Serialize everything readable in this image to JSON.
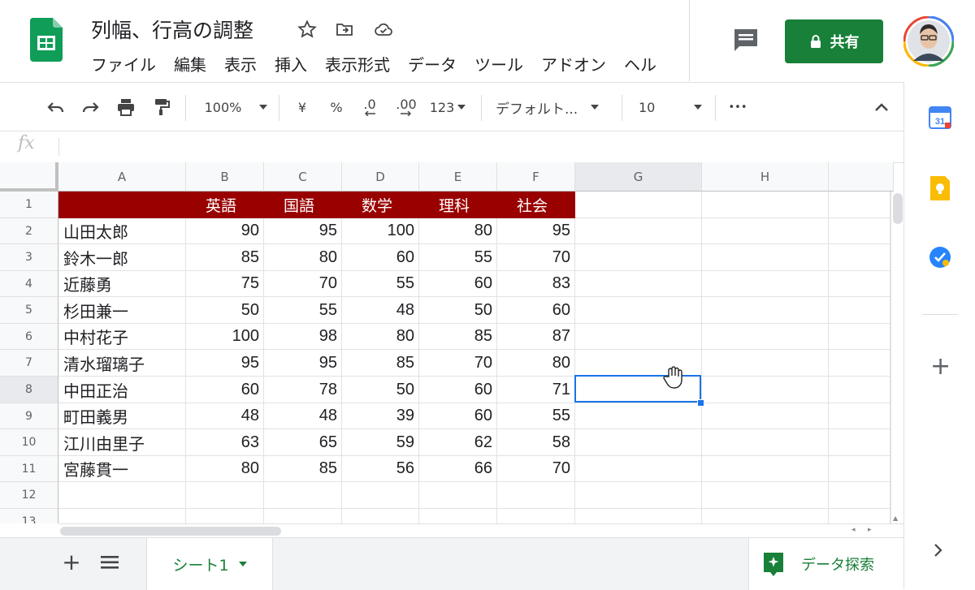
{
  "app": {
    "title": "列幅、行高の調整",
    "menu": [
      "ファイル",
      "編集",
      "表示",
      "挿入",
      "表示形式",
      "データ",
      "ツール",
      "アドオン",
      "ヘル"
    ],
    "share_label": "共有"
  },
  "toolbar": {
    "zoom": "100%",
    "currency": "¥",
    "percent": "%",
    "decrease_decimal": ".0",
    "increase_decimal": ".00",
    "number_format": "123",
    "font": "デフォルト...",
    "font_size": "10",
    "more": "•••"
  },
  "formula_bar": {
    "fx_label": "fx",
    "value": ""
  },
  "grid": {
    "columns": [
      "A",
      "B",
      "C",
      "D",
      "E",
      "F",
      "G",
      "H"
    ],
    "rows": [
      "1",
      "2",
      "3",
      "4",
      "5",
      "6",
      "7",
      "8",
      "9",
      "10",
      "11",
      "12",
      "13"
    ],
    "header_row": [
      "",
      "英語",
      "国語",
      "数学",
      "理科",
      "社会"
    ],
    "data": [
      [
        "山田太郎",
        "90",
        "95",
        "100",
        "80",
        "95"
      ],
      [
        "鈴木一郎",
        "85",
        "80",
        "60",
        "55",
        "70"
      ],
      [
        "近藤勇",
        "75",
        "70",
        "55",
        "60",
        "83"
      ],
      [
        "杉田兼一",
        "50",
        "55",
        "48",
        "50",
        "60"
      ],
      [
        "中村花子",
        "100",
        "98",
        "80",
        "85",
        "87"
      ],
      [
        "清水瑠璃子",
        "95",
        "95",
        "85",
        "70",
        "80"
      ],
      [
        "中田正治",
        "60",
        "78",
        "50",
        "60",
        "71"
      ],
      [
        "町田義男",
        "48",
        "48",
        "39",
        "60",
        "55"
      ],
      [
        "江川由里子",
        "63",
        "65",
        "59",
        "62",
        "58"
      ],
      [
        "宮藤貫一",
        "80",
        "85",
        "56",
        "66",
        "70"
      ]
    ],
    "selected_cell": "G8"
  },
  "sheets": {
    "tabs": [
      "シート1"
    ]
  },
  "explore_label": "データ探索",
  "colors": {
    "header_fill": "#990000",
    "share_green": "#188038",
    "selection_blue": "#1a73e8"
  }
}
